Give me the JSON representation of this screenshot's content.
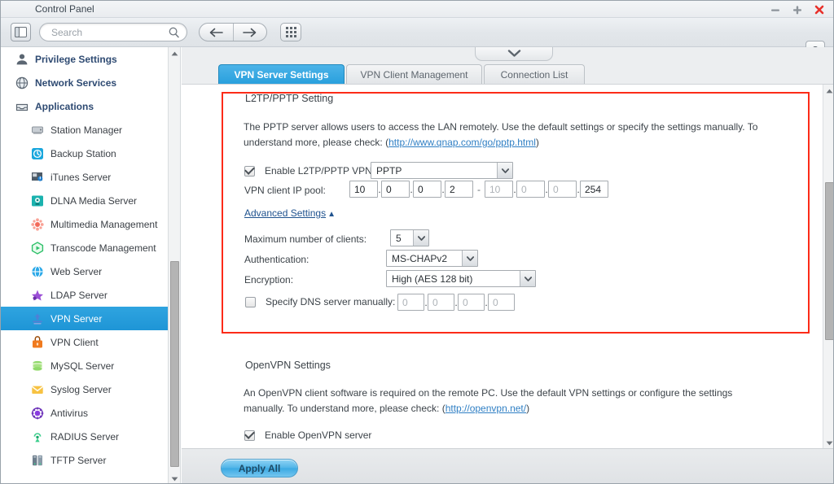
{
  "window": {
    "title": "Control Panel",
    "controls": {
      "minimize": "minimize",
      "maximize": "maximize",
      "close": "close"
    }
  },
  "toolbar": {
    "panel_toggle_icon": "panel-layout-icon",
    "search": {
      "placeholder": "Search",
      "value": "",
      "icon": "search-icon"
    },
    "back_icon": "arrow-left-icon",
    "forward_icon": "arrow-right-icon",
    "apps_grid_icon": "app-grid-icon",
    "help_label": "?"
  },
  "sidebar": {
    "items": [
      {
        "label": "Privilege Settings",
        "icon": "user-icon",
        "level": "top",
        "active": false
      },
      {
        "label": "Network Services",
        "icon": "globe-icon",
        "level": "top",
        "active": false
      },
      {
        "label": "Applications",
        "icon": "tray-icon",
        "level": "top",
        "active": false
      },
      {
        "label": "Station Manager",
        "icon": "station-manager-icon",
        "level": "child",
        "active": false
      },
      {
        "label": "Backup Station",
        "icon": "backup-station-icon",
        "level": "child",
        "active": false
      },
      {
        "label": "iTunes Server",
        "icon": "itunes-server-icon",
        "level": "child",
        "active": false
      },
      {
        "label": "DLNA Media Server",
        "icon": "dlna-media-server-icon",
        "level": "child",
        "active": false
      },
      {
        "label": "Multimedia Management",
        "icon": "multimedia-management-icon",
        "level": "child",
        "active": false
      },
      {
        "label": "Transcode Management",
        "icon": "transcode-management-icon",
        "level": "child",
        "active": false
      },
      {
        "label": "Web Server",
        "icon": "web-server-icon",
        "level": "child",
        "active": false
      },
      {
        "label": "LDAP Server",
        "icon": "ldap-server-icon",
        "level": "child",
        "active": false
      },
      {
        "label": "VPN Server",
        "icon": "vpn-server-icon",
        "level": "child",
        "active": true
      },
      {
        "label": "VPN Client",
        "icon": "vpn-client-icon",
        "level": "child",
        "active": false
      },
      {
        "label": "MySQL Server",
        "icon": "mysql-server-icon",
        "level": "child",
        "active": false
      },
      {
        "label": "Syslog Server",
        "icon": "syslog-server-icon",
        "level": "child",
        "active": false
      },
      {
        "label": "Antivirus",
        "icon": "antivirus-icon",
        "level": "child",
        "active": false
      },
      {
        "label": "RADIUS Server",
        "icon": "radius-server-icon",
        "level": "child",
        "active": false
      },
      {
        "label": "TFTP Server",
        "icon": "tftp-server-icon",
        "level": "child",
        "active": false
      }
    ]
  },
  "tabs": [
    {
      "label": "VPN Server Settings",
      "selected": true
    },
    {
      "label": "VPN Client Management",
      "selected": false
    },
    {
      "label": "Connection List",
      "selected": false
    }
  ],
  "tab_collapse_icon": "chevron-down-icon",
  "l2tp": {
    "section_title": "L2TP/PPTP Setting",
    "description_part1": "The PPTP server allows users to access the LAN remotely. Use the default settings or specify the settings manually. To",
    "description_part2_prefix": "understand more, please check: (",
    "link_text": "http://www.qnap.com/go/pptp.html",
    "description_part2_suffix": ")",
    "enable_label": "Enable L2TP/PPTP VPN server",
    "enable_checked": true,
    "protocol_value": "PPTP",
    "ip_pool_label": "VPN client IP pool:",
    "ip_pool_start": [
      "10",
      "0",
      "0",
      "2"
    ],
    "ip_pool_end": [
      "10",
      "0",
      "0",
      "254"
    ],
    "ip_pool_end_disabled": [
      true,
      true,
      true,
      false
    ],
    "range_separator": "-",
    "advanced_link": "Advanced Settings",
    "advanced_arrow": "▲",
    "max_clients_label": "Maximum number of clients:",
    "max_clients_value": "5",
    "auth_label": "Authentication:",
    "auth_value": "MS-CHAPv2",
    "encryption_label": "Encryption:",
    "encryption_value": "High (AES 128 bit)",
    "dns_label": "Specify DNS server manually:",
    "dns_checked": false,
    "dns_values": [
      "0",
      "0",
      "0",
      "0"
    ]
  },
  "openvpn": {
    "section_title": "OpenVPN Settings",
    "description_part1": "An OpenVPN client software is required on the remote PC. Use the default VPN settings or configure the settings",
    "description_part2_prefix": "manually. To understand more, please check: (",
    "link_text": "http://openvpn.net/",
    "description_part2_suffix": ")",
    "enable_label": "Enable OpenVPN server",
    "enable_checked": true
  },
  "footer": {
    "apply_label": "Apply All"
  },
  "colors": {
    "accent": "#29a0dd",
    "highlight_box": "#fc2b18",
    "link": "#2f7fc4",
    "sidebar_link": "#2f4a73"
  }
}
